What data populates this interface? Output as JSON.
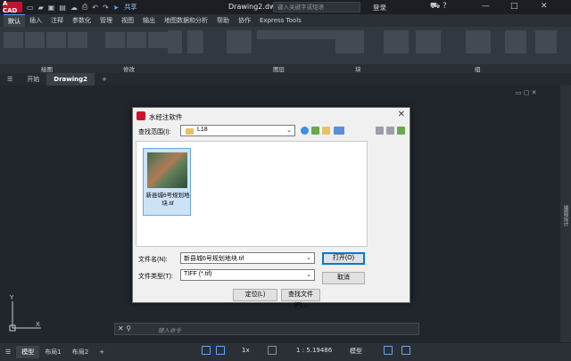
{
  "titlebar": {
    "logo": "A CAD",
    "share": "共享",
    "doc_title": "Drawing2.dwg",
    "search_placeholder": "键入关键字或短语",
    "login": "登录"
  },
  "menu_tabs": [
    "默认",
    "插入",
    "注释",
    "参数化",
    "管理",
    "视图",
    "输出",
    "地图数据和分析",
    "帮助",
    "协作",
    "Express Tools"
  ],
  "active_menu_tab": "默认",
  "ribbon_panels": [
    "绘图",
    "修改",
    "图层",
    "块",
    "组"
  ],
  "file_tabs": [
    "开始",
    "Drawing2"
  ],
  "active_file_tab": "Drawing2",
  "right_panel_label": "端面设计",
  "command_placeholder": "键入命令",
  "ucs": {
    "y": "Y",
    "x": "X"
  },
  "status": {
    "layout_tabs": [
      "模型",
      "布局1",
      "布局2"
    ],
    "active_layout": "模型",
    "zoom": "1x",
    "scale": "1 : 5.19486",
    "model": "模型"
  },
  "dialog": {
    "title": "水经注软件",
    "lookin_label": "查找范围(I):",
    "lookin_value": "L18",
    "file_item_label": "新县城6号规划地块.tif",
    "filename_label": "文件名(N):",
    "filename_value": "新县城6号规划地块.tif",
    "filetype_label": "文件类型(T):",
    "filetype_value": "TIFF (*.tif)",
    "open_button": "打开(O)",
    "cancel_button": "取消",
    "locate_button": "定位(L)",
    "find_button": "查找文件(F)..."
  },
  "colors": {
    "accent": "#0078d7",
    "logo": "#c8102e",
    "canvas": "#21262c"
  }
}
